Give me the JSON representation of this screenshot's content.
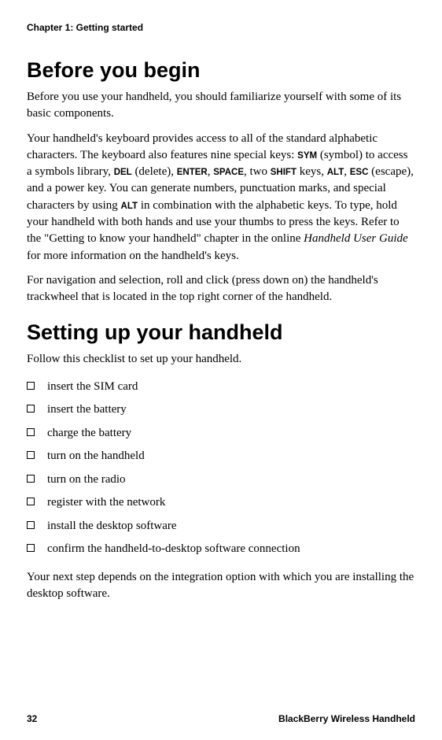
{
  "chapter_header": "Chapter 1: Getting started",
  "section1": {
    "heading": "Before you begin",
    "para1": "Before you use your handheld, you should familiarize yourself with some of its basic components.",
    "para2_pre": "Your handheld's keyboard provides access to all of the standard alphabetic characters. The keyboard also features nine special keys: ",
    "key_sym": "SYM",
    "para2_a": " (symbol) to access a symbols library, ",
    "key_del": "DEL",
    "para2_b": " (delete),  ",
    "key_enter": "ENTER",
    "para2_c": ", ",
    "key_space": "SPACE",
    "para2_d": ", two ",
    "key_shift": "SHIFT",
    "para2_e": " keys, ",
    "key_alt": "ALT",
    "para2_f": ", ",
    "key_esc": "ESC",
    "para2_g": " (escape), and a power key. You can generate numbers,  punctuation marks, and special characters by using ",
    "key_alt2": "ALT",
    "para2_h": " in combination with the alphabetic keys. To type, hold your handheld with both hands and use your thumbs to press the keys. Refer to the \"Getting to know your handheld\" chapter in the online ",
    "italic_guide": "Handheld User Guide",
    "para2_i": " for more information on the handheld's keys.",
    "para3": "For navigation and selection, roll and click (press down on) the handheld's trackwheel that is located in the top right corner of the handheld."
  },
  "section2": {
    "heading": "Setting up your handheld",
    "intro": "Follow this checklist to set up your handheld.",
    "items": [
      "insert the SIM card",
      "insert the battery",
      "charge the battery",
      "turn on the handheld",
      "turn on the radio",
      "register with the network",
      "install the desktop software",
      "confirm the handheld-to-desktop software connection"
    ],
    "outro": "Your next step depends on the integration option with which you are installing the desktop software."
  },
  "footer": {
    "page": "32",
    "brand": "BlackBerry Wireless Handheld"
  }
}
